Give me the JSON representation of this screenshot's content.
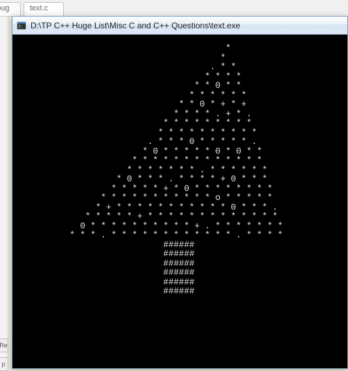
{
  "background": {
    "tab1_label": "ebug",
    "tab2_label": "text.c",
    "left_btn1": "Re",
    "left_btn2": "p"
  },
  "console": {
    "icon_name": "console-app-icon",
    "title": "D:\\TP C++ Huge List\\Misc C and C++ Questions\\text.exe",
    "tree_lines": [
      "                    *",
      "                   *  ",
      "                  . * *",
      "                 * * * *",
      "                * * 0 * *",
      "               * * * * * *",
      "              * * 0 * + * +",
      "             * * * * . + * .",
      "            * * * * * * * * *",
      "           * * * * * * * * * *",
      "          . * * * 0 * * * * * .",
      "         * 0 * * * * * 0 * 0 * *",
      "        * * * * * * * * * * * * *",
      "       * * * * * * * . * * * * * *",
      "      * 0 * * * . * * * * + 0 * * *",
      "     * * * * * + * 0 * * * * * * * *",
      "    * * * * * * * * * * * o * * * * *",
      "   * + * * * * * * * * * * * 0 * * * .",
      "  * * * * * + * * * * * * * * * * * * *",
      " 0 * * * * * * * * * * + . * * * * * * *",
      "* * * . * * * * * * * * * * * * . * * * *",
      "                 ######",
      "                 ######",
      "                 ######",
      "                 ######",
      "                 ######",
      "                 ######"
    ]
  }
}
